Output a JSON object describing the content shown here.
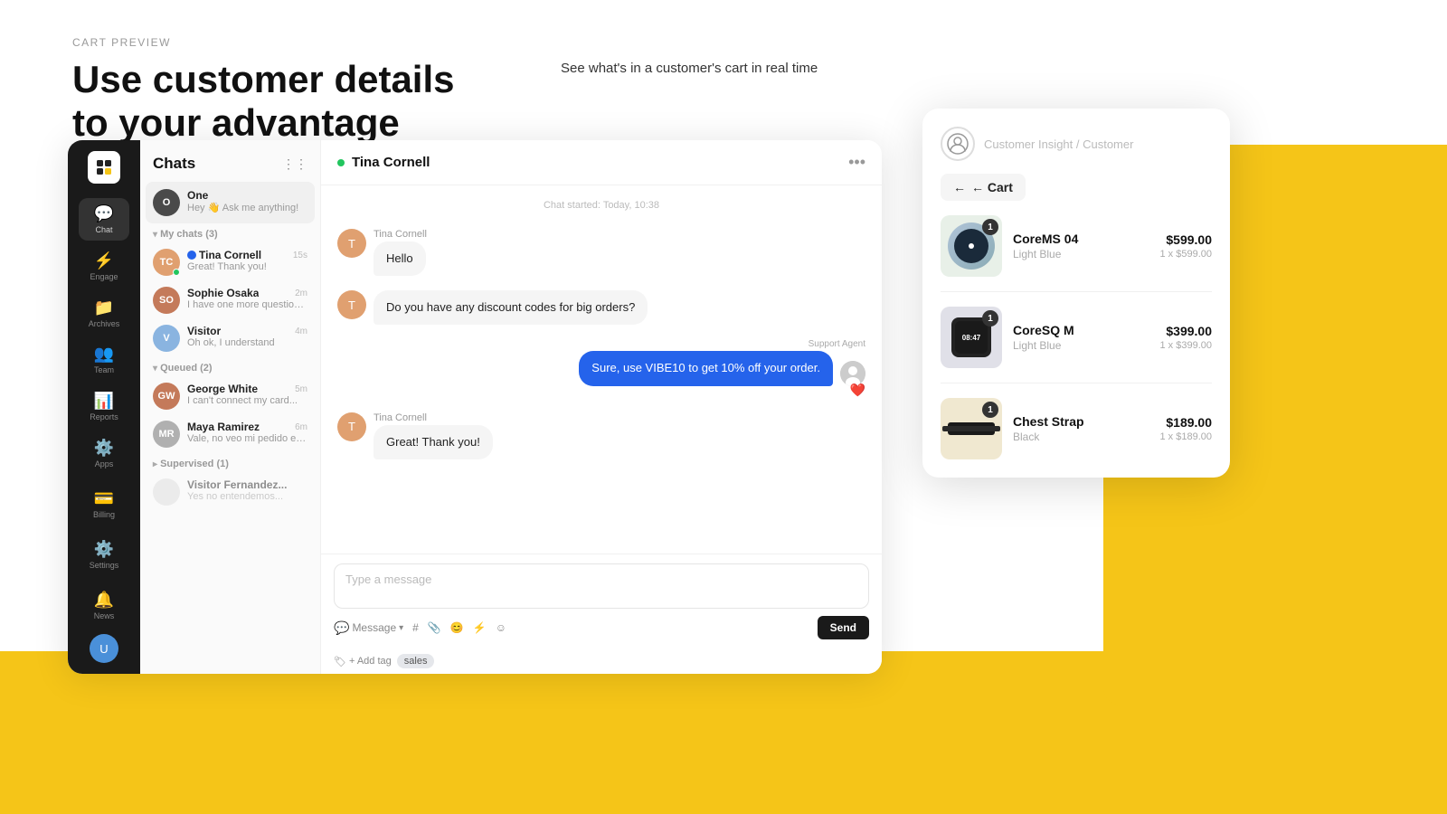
{
  "page": {
    "cart_preview_label": "CART PREVIEW",
    "main_title_line1": "Use customer details",
    "main_title_line2": "to your advantage",
    "annotation_text": "See what's in a customer's cart in real time"
  },
  "sidebar": {
    "items": [
      {
        "label": "Chat",
        "icon": "💬",
        "active": true
      },
      {
        "label": "Engage",
        "icon": "⚡"
      },
      {
        "label": "Archives",
        "icon": "📁"
      },
      {
        "label": "Team",
        "icon": "👥"
      },
      {
        "label": "Reports",
        "icon": "📊"
      },
      {
        "label": "Apps",
        "icon": "⚙️"
      }
    ],
    "bottom_items": [
      {
        "label": "Billing",
        "icon": "💳"
      },
      {
        "label": "Settings",
        "icon": "⚙️"
      },
      {
        "label": "News",
        "icon": "🔔"
      }
    ]
  },
  "chat_list": {
    "title": "Chats",
    "my_chats_label": "My chats (3)",
    "queued_label": "Queued (2)",
    "supervised_label": "Supervised (1)",
    "items": [
      {
        "name": "One",
        "preview": "Hey 👋 Ask me anything!",
        "time": "",
        "active": true,
        "avatar_color": "#4a4a4a",
        "initials": "O"
      },
      {
        "name": "Tina Cornell",
        "preview": "Great! Thank you!",
        "time": "15s",
        "avatar_color": "#e0a070",
        "initials": "TC",
        "verified": true
      },
      {
        "name": "Sophie Osaka",
        "preview": "I have one more question. Could...",
        "time": "2m",
        "avatar_color": "#c47a5a",
        "initials": "SO"
      },
      {
        "name": "Visitor",
        "preview": "Oh ok, I understand",
        "time": "4m",
        "avatar_color": "#8ab4e0",
        "initials": "V"
      },
      {
        "name": "George White",
        "preview": "I can't connect my card...",
        "time": "5m",
        "avatar_color": "#c47a5a",
        "initials": "GW"
      },
      {
        "name": "Maya Ramirez",
        "preview": "Vale, no veo mi pedido en la lista...",
        "time": "6m",
        "avatar_color": "#b0b0b0",
        "initials": "MR"
      }
    ]
  },
  "chat_window": {
    "contact_name": "Tina Cornell",
    "chat_started": "Chat started: Today, 10:38",
    "messages": [
      {
        "sender": "Tina Cornell",
        "text": "Hello",
        "type": "received"
      },
      {
        "sender": "Tina Cornell",
        "text": "Do you have any discount codes for big orders?",
        "type": "received"
      },
      {
        "sender": "Support Agent",
        "text": "Sure, use VIBE10 to get 10% off your order.",
        "type": "sent"
      },
      {
        "sender": "Tina Cornell",
        "text": "Great! Thank you!",
        "type": "received"
      }
    ],
    "input_placeholder": "Type a message",
    "send_button": "Send",
    "toolbar_items": [
      "Message",
      "#",
      "📎",
      "😊",
      "⚡",
      "☺"
    ],
    "tags": [
      "sales"
    ],
    "add_tag_label": "+ Add tag"
  },
  "insight_panel": {
    "breadcrumb": "Customer Insight / Customer",
    "back_button": "← Cart",
    "cart_items": [
      {
        "name": "CoreMS 04",
        "price": "$599.00",
        "variant": "Light Blue",
        "qty": "1 x $599.00",
        "badge": "1",
        "type": "round_watch"
      },
      {
        "name": "CoreSQ M",
        "price": "$399.00",
        "variant": "Light Blue",
        "qty": "1 x $399.00",
        "badge": "1",
        "type": "sq_watch"
      },
      {
        "name": "Chest Strap",
        "price": "$189.00",
        "variant": "Black",
        "qty": "1 x $189.00",
        "badge": "1",
        "type": "chest_strap"
      }
    ]
  }
}
